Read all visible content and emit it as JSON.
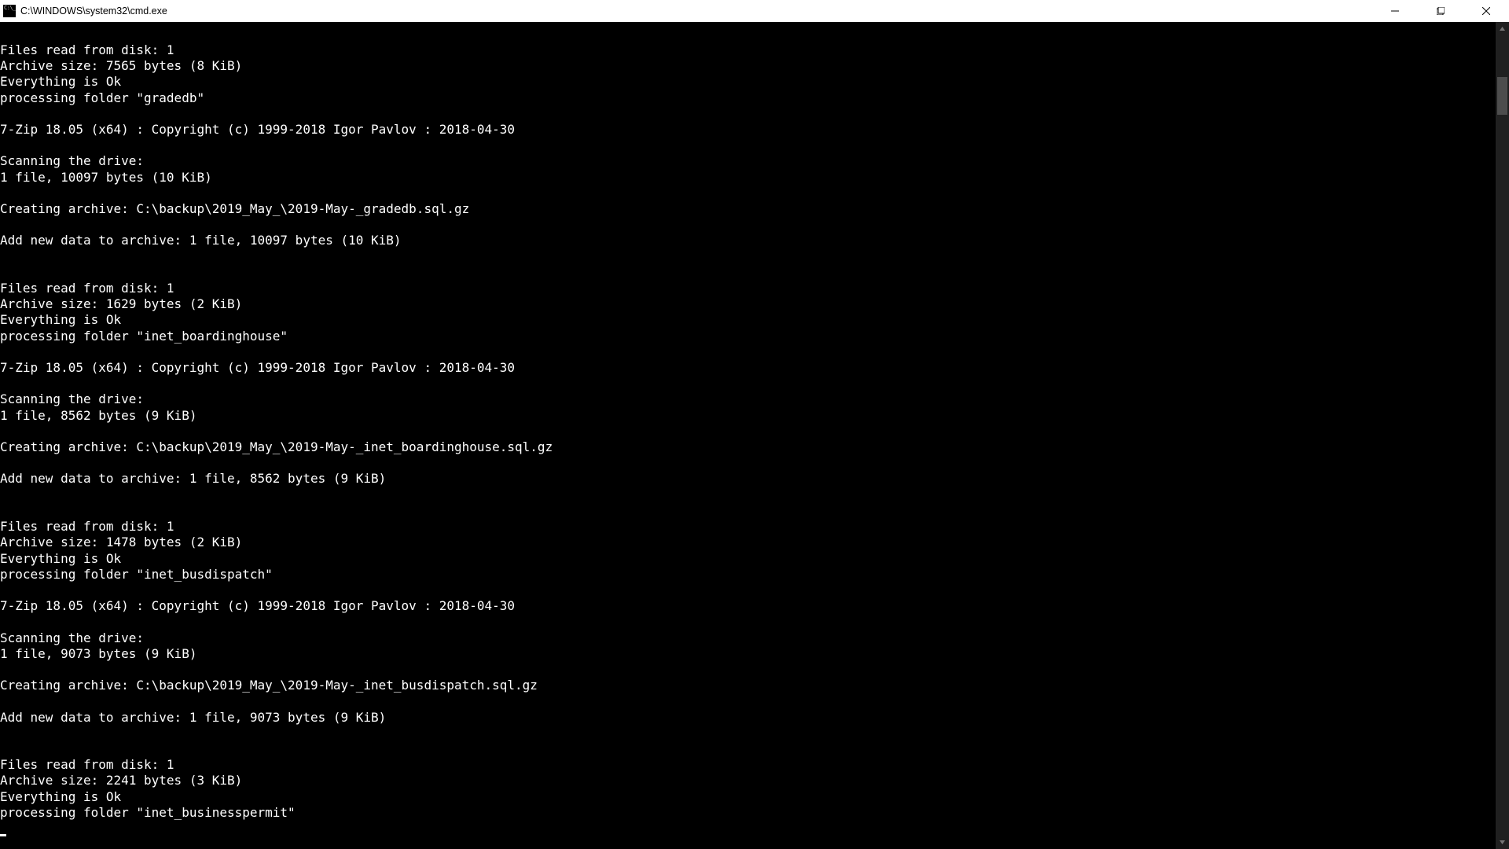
{
  "window": {
    "title": "C:\\WINDOWS\\system32\\cmd.exe"
  },
  "terminal": {
    "lines": [
      "Files read from disk: 1",
      "Archive size: 7565 bytes (8 KiB)",
      "Everything is Ok",
      "processing folder \"gradedb\"",
      "",
      "7-Zip 18.05 (x64) : Copyright (c) 1999-2018 Igor Pavlov : 2018-04-30",
      "",
      "Scanning the drive:",
      "1 file, 10097 bytes (10 KiB)",
      "",
      "Creating archive: C:\\backup\\2019_May_\\2019-May-_gradedb.sql.gz",
      "",
      "Add new data to archive: 1 file, 10097 bytes (10 KiB)",
      "",
      "",
      "Files read from disk: 1",
      "Archive size: 1629 bytes (2 KiB)",
      "Everything is Ok",
      "processing folder \"inet_boardinghouse\"",
      "",
      "7-Zip 18.05 (x64) : Copyright (c) 1999-2018 Igor Pavlov : 2018-04-30",
      "",
      "Scanning the drive:",
      "1 file, 8562 bytes (9 KiB)",
      "",
      "Creating archive: C:\\backup\\2019_May_\\2019-May-_inet_boardinghouse.sql.gz",
      "",
      "Add new data to archive: 1 file, 8562 bytes (9 KiB)",
      "",
      "",
      "Files read from disk: 1",
      "Archive size: 1478 bytes (2 KiB)",
      "Everything is Ok",
      "processing folder \"inet_busdispatch\"",
      "",
      "7-Zip 18.05 (x64) : Copyright (c) 1999-2018 Igor Pavlov : 2018-04-30",
      "",
      "Scanning the drive:",
      "1 file, 9073 bytes (9 KiB)",
      "",
      "Creating archive: C:\\backup\\2019_May_\\2019-May-_inet_busdispatch.sql.gz",
      "",
      "Add new data to archive: 1 file, 9073 bytes (9 KiB)",
      "",
      "",
      "Files read from disk: 1",
      "Archive size: 2241 bytes (3 KiB)",
      "Everything is Ok",
      "processing folder \"inet_businesspermit\""
    ]
  }
}
